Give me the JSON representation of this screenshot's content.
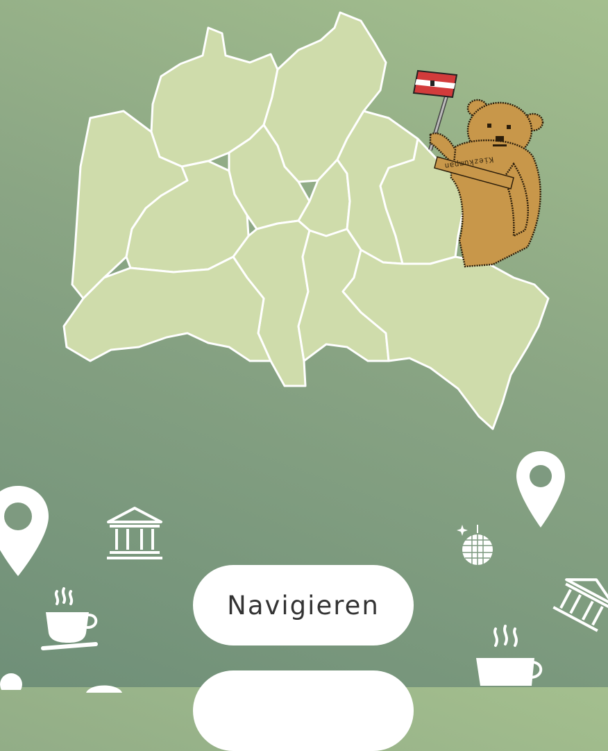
{
  "buttons": {
    "navigate_label": "Navigieren",
    "second_label": ""
  },
  "bear": {
    "sash_text": "Kiezkumpan"
  },
  "decorations": [
    "location-pin-icon",
    "museum-icon",
    "coffee-cup-icon",
    "disco-ball-icon"
  ],
  "colors": {
    "map_fill": "#cfdcab",
    "map_border": "#ffffff",
    "bear": "#c8974a",
    "button_bg": "#ffffff",
    "button_text": "#333333",
    "icon_color": "#ffffff"
  }
}
